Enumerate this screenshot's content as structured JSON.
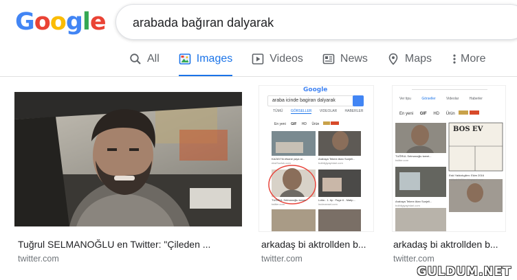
{
  "logo": {
    "letters": [
      "G",
      "o",
      "o",
      "g",
      "l",
      "e"
    ],
    "colors": [
      "#4285F4",
      "#EA4335",
      "#FBBC05",
      "#4285F4",
      "#34A853",
      "#EA4335"
    ]
  },
  "search": {
    "query": "arabada bağıran dalyarak"
  },
  "tabs": [
    {
      "label": "All",
      "icon": "search-icon"
    },
    {
      "label": "Images",
      "icon": "image-icon",
      "active": true
    },
    {
      "label": "Videos",
      "icon": "play-icon"
    },
    {
      "label": "News",
      "icon": "newspaper-icon"
    },
    {
      "label": "Maps",
      "icon": "map-pin-icon"
    },
    {
      "label": "More",
      "icon": "more-vertical-icon"
    }
  ],
  "results": [
    {
      "title": "Tuğrul SELMANOĞLU en Twitter: \"Çileden ...",
      "source": "twitter.com"
    },
    {
      "title": "arkadaş bi aktrollden b...",
      "source": "twitter.com"
    },
    {
      "title": "arkadaş bi aktrollden b...",
      "source": "twitter.com"
    }
  ],
  "thumb2": {
    "logo": "Google",
    "query": "araba icinde bagiran dalyarak",
    "tabs": [
      "TÜMÜ",
      "GÖRSELLER",
      "VIDEOLAR",
      "HABERLER"
    ],
    "chips": [
      "En yeni",
      "GIF",
      "HD",
      "Ürün"
    ],
    "labels": [
      "KAZAYI'lü efsane yaya ar...",
      "Arabaya Tekme Atan Sunjeli...",
      "TUĞRUL Selmanoğlu tweet...",
      "Lotta - 1. tip : Page 6 - Matip..."
    ],
    "sources": [
      "eksiSozluk.com",
      "bolbilgiyayinlari.com",
      "twitter.com",
      "incimanset.com"
    ]
  },
  "thumb3": {
    "tabs": [
      "Ver tipu",
      "Görseller",
      "Videolar",
      "Haberler"
    ],
    "chips": [
      "En yeni",
      "GIF",
      "HD",
      "Ürün"
    ],
    "comic": "BOS EV",
    "labels": [
      "TUĞRUL Selmanoğlu tweet...",
      "Eski Yaldızlıgilen: Ekim 2016",
      "Arabaya Tekme Atan Sunjeli..."
    ],
    "sources": [
      "twitter.com",
      "eskiyaldizlikler.blogspot.com",
      "bolbilgiyayinlari.com"
    ]
  },
  "watermark": "GULDUM.NET"
}
